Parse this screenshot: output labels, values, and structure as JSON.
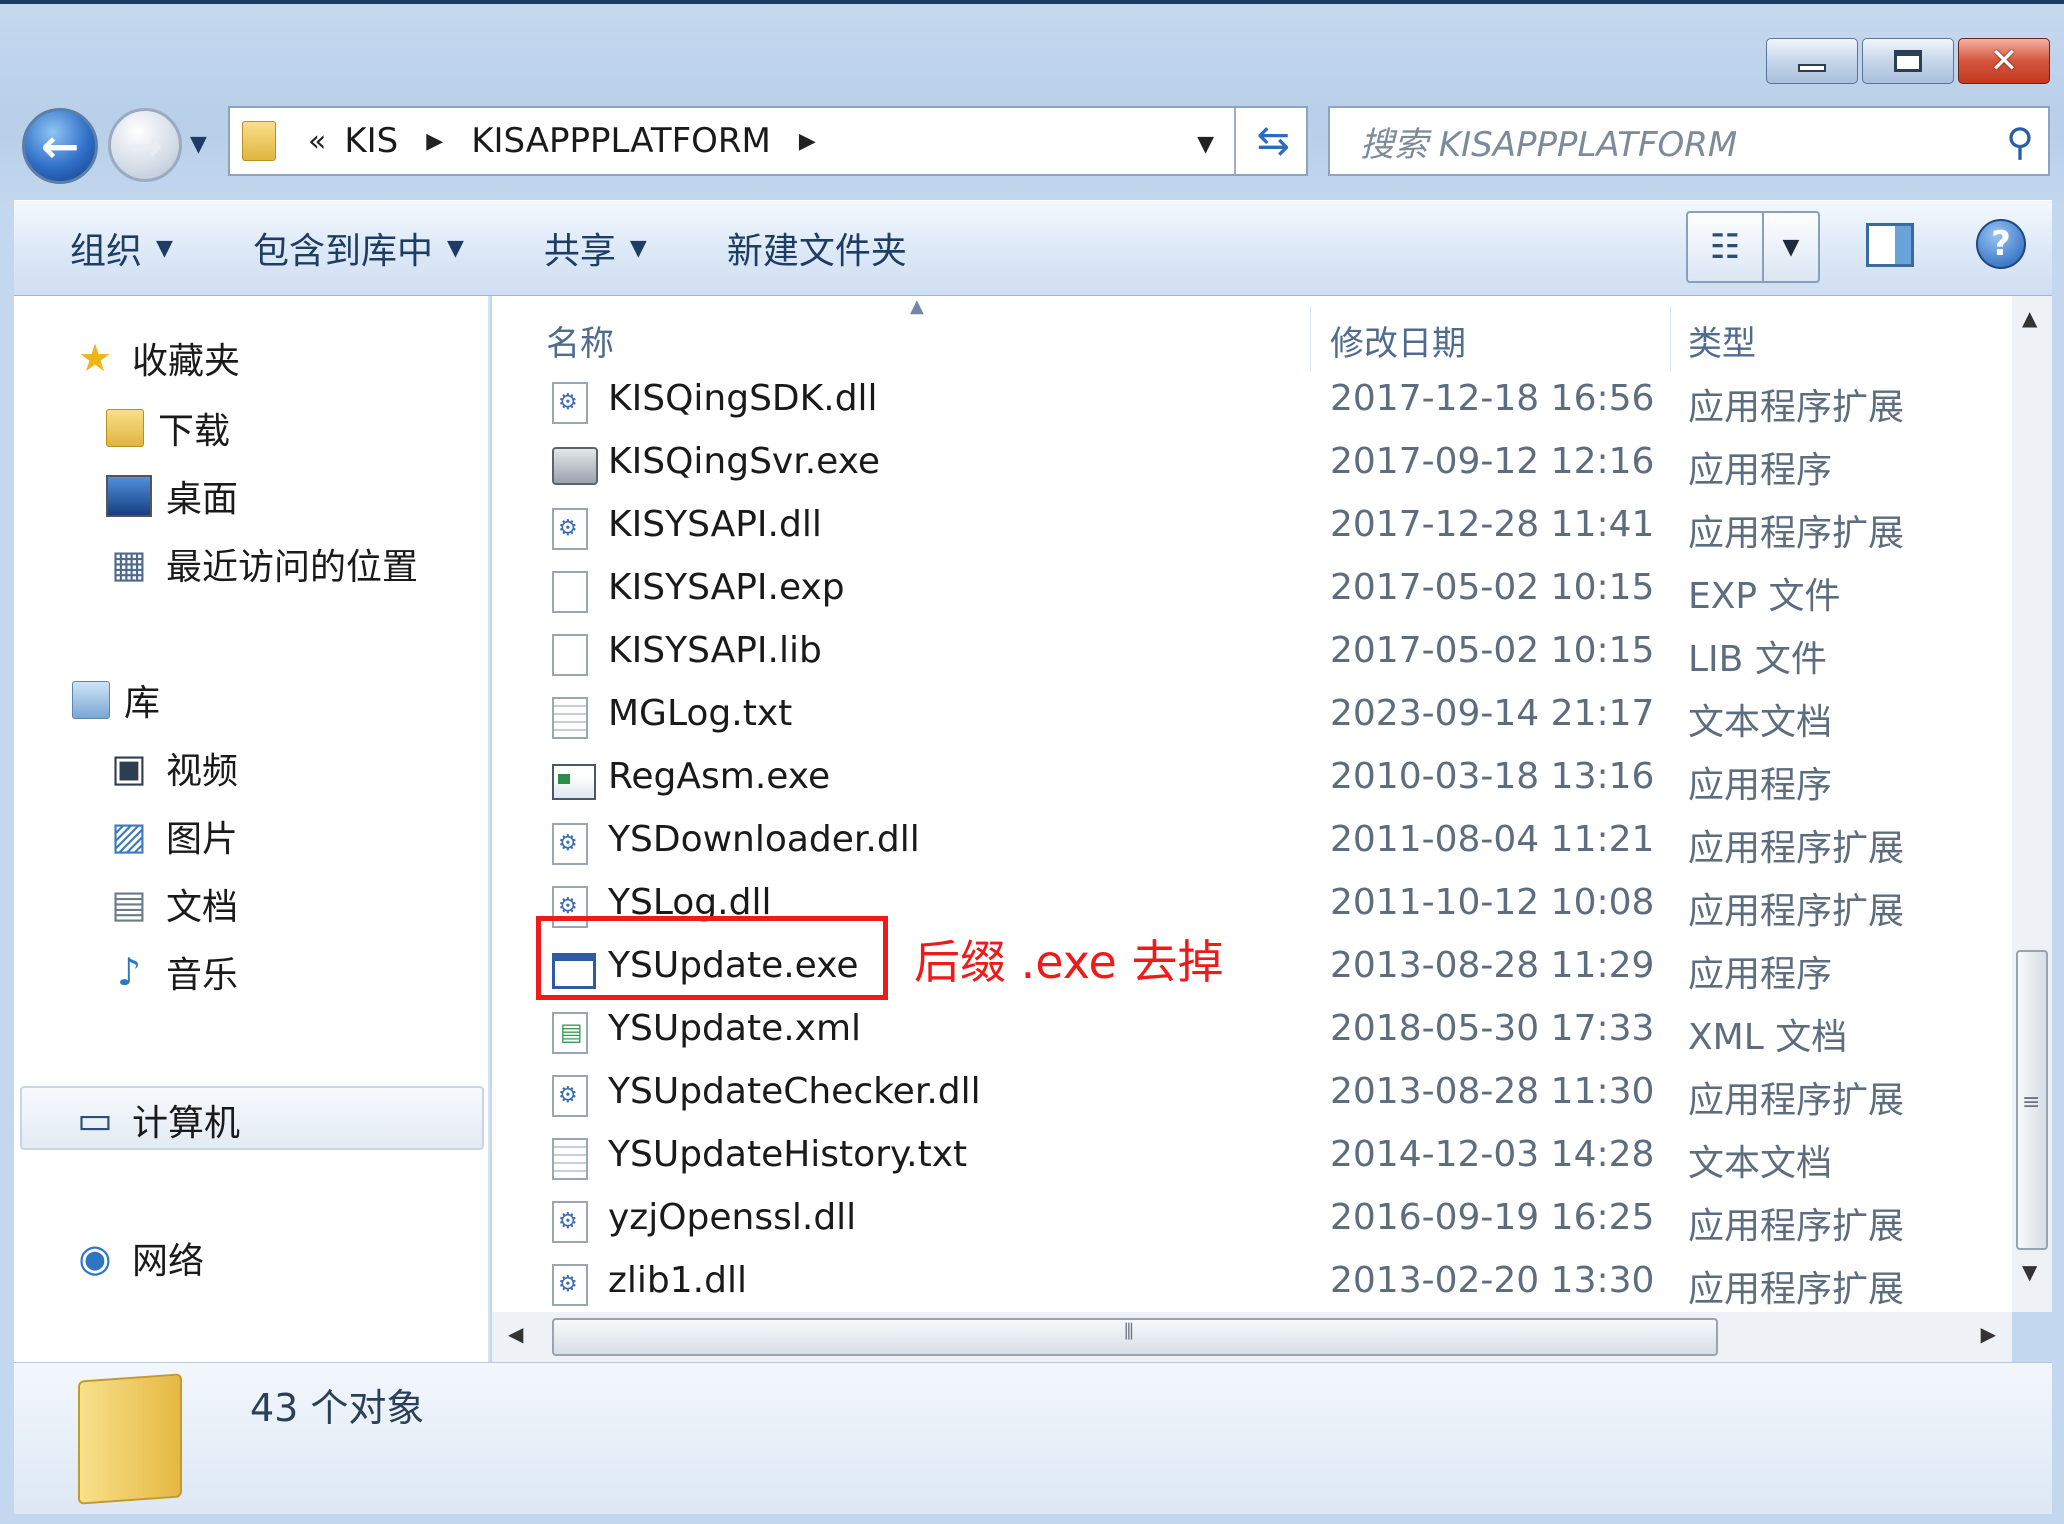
{
  "window": {
    "caption": {
      "minimize": "",
      "maximize": "",
      "close": "✕"
    }
  },
  "address": {
    "chevron": "«",
    "parts": [
      "KIS",
      "KISAPPPLATFORM"
    ]
  },
  "search": {
    "placeholder": "搜索 KISAPPPLATFORM"
  },
  "toolbar": {
    "items": [
      "组织",
      "包含到库中",
      "共享",
      "新建文件夹"
    ]
  },
  "nav": {
    "favorites": "收藏夹",
    "favorites_items": [
      "下载",
      "桌面",
      "最近访问的位置"
    ],
    "libraries": "库",
    "library_items": [
      "视频",
      "图片",
      "文档",
      "音乐"
    ],
    "computer": "计算机",
    "network": "网络"
  },
  "columns": {
    "name": "名称",
    "date": "修改日期",
    "type": "类型"
  },
  "files": [
    {
      "name": "KISQingSDK.dll",
      "date": "2017-12-18 16:56",
      "type": "应用程序扩展",
      "icon": "dll"
    },
    {
      "name": "KISQingSvr.exe",
      "date": "2017-09-12 12:16",
      "type": "应用程序",
      "icon": "svr"
    },
    {
      "name": "KISYSAPI.dll",
      "date": "2017-12-28 11:41",
      "type": "应用程序扩展",
      "icon": "dll"
    },
    {
      "name": "KISYSAPI.exp",
      "date": "2017-05-02 10:15",
      "type": "EXP 文件",
      "icon": "blank"
    },
    {
      "name": "KISYSAPI.lib",
      "date": "2017-05-02 10:15",
      "type": "LIB 文件",
      "icon": "blank"
    },
    {
      "name": "MGLog.txt",
      "date": "2023-09-14 21:17",
      "type": "文本文档",
      "icon": "txt"
    },
    {
      "name": "RegAsm.exe",
      "date": "2010-03-18 13:16",
      "type": "应用程序",
      "icon": "regasm"
    },
    {
      "name": "YSDownloader.dll",
      "date": "2011-08-04 11:21",
      "type": "应用程序扩展",
      "icon": "dll"
    },
    {
      "name": "YSLog.dll",
      "date": "2011-10-12 10:08",
      "type": "应用程序扩展",
      "icon": "dll"
    },
    {
      "name": "YSUpdate.exe",
      "date": "2013-08-28 11:29",
      "type": "应用程序",
      "icon": "exe"
    },
    {
      "name": "YSUpdate.xml",
      "date": "2018-05-30 17:33",
      "type": "XML 文档",
      "icon": "xml"
    },
    {
      "name": "YSUpdateChecker.dll",
      "date": "2013-08-28 11:30",
      "type": "应用程序扩展",
      "icon": "dll"
    },
    {
      "name": "YSUpdateHistory.txt",
      "date": "2014-12-03 14:28",
      "type": "文本文档",
      "icon": "txt"
    },
    {
      "name": "yzjOpenssl.dll",
      "date": "2016-09-19 16:25",
      "type": "应用程序扩展",
      "icon": "dll"
    },
    {
      "name": "zlib1.dll",
      "date": "2013-02-20 13:30",
      "type": "应用程序扩展",
      "icon": "dll"
    }
  ],
  "annotation": {
    "text": "后缀 .exe 去掉",
    "color": "#ee1b1b"
  },
  "status": {
    "count": "43 个对象"
  }
}
